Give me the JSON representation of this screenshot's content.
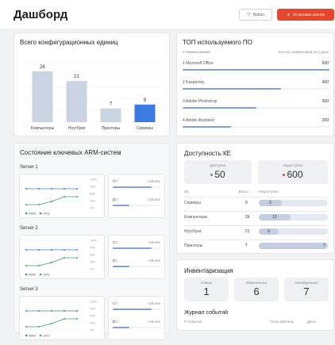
{
  "header": {
    "title": "Дашборд",
    "button_label": "Button",
    "primary_label": "Установка агента"
  },
  "config_units": {
    "title": "Всего конфигурационных единиц",
    "chart_data": {
      "type": "bar",
      "categories": [
        "Компьютеры",
        "Ноутбуки",
        "Принтеры",
        "Серверы"
      ],
      "values": [
        26,
        21,
        7,
        9
      ],
      "highlight_index": 3,
      "colors": {
        "bar": "#c9d3e2",
        "highlight": "#3b7ae0"
      }
    }
  },
  "top_software": {
    "title": "ТОП используемого ПО",
    "col_name": "#  Наименование",
    "col_count": "Кол-во экземпляров за 1 день",
    "items": [
      {
        "label": "1  Microsoft Office",
        "value": "600",
        "fraction": 1.0
      },
      {
        "label": "2  Kaspersky",
        "value": "400",
        "fraction": 0.67
      },
      {
        "label": "3  Adobe Photoshop",
        "value": "300",
        "fraction": 0.5
      },
      {
        "label": "4  Adobe Illustrator",
        "value": "200",
        "fraction": 0.33
      }
    ]
  },
  "arm": {
    "title": "Состояние ключевых ARM-систем",
    "y_ticks": [
      "100%",
      "75%",
      "50%",
      "25%",
      "0%"
    ],
    "legend_ram": "RAM",
    "legend_cpu": "CPU",
    "colors": {
      "ram": "#3b7ae0",
      "cpu": "#3aa657"
    },
    "servers": [
      {
        "name": "Server 1",
        "disk_c": "C:\\",
        "disk_d": "D:\\",
        "volume_label": "Volume",
        "disk_c_fraction": 0.8,
        "disk_d_fraction": 0.35
      },
      {
        "name": "Server 2",
        "disk_c": "C:\\",
        "disk_d": "D:\\",
        "volume_label": "Volume",
        "disk_c_fraction": 0.8,
        "disk_d_fraction": 0.35
      },
      {
        "name": "Server 3",
        "disk_c": "C:\\",
        "disk_d": "D:\\",
        "volume_label": "Volume",
        "disk_c_fraction": 0.8,
        "disk_d_fraction": 0.35
      }
    ]
  },
  "availability": {
    "title": "Доступность КЕ",
    "available_label": "Доступно",
    "available_value": "50",
    "unavailable_label": "Недоступно",
    "unavailable_value": "600",
    "col_ke": "КЕ",
    "col_total": "Всего",
    "col_unavailable": "Недоступно",
    "rows": [
      {
        "name": "Серверы",
        "total": "9",
        "unavail": "3",
        "fraction": 0.33
      },
      {
        "name": "Компьютеры",
        "total": "26",
        "unavail": "12",
        "fraction": 0.46
      },
      {
        "name": "Ноутбуки",
        "total": "21",
        "unavail": "6",
        "fraction": 0.29
      },
      {
        "name": "Принтеры",
        "total": "7",
        "unavail": "7",
        "fraction": 1.0
      }
    ],
    "colors": {
      "available": "#3aa657",
      "unavailable": "#e8462a"
    }
  },
  "inventory": {
    "title": "Инвентаризация",
    "new_label": "Новые",
    "new_value": "1",
    "changed_label": "Измененные",
    "changed_value": "6",
    "missing_label": "Ненайденные",
    "missing_value": "7"
  },
  "events": {
    "title": "Журнал событий",
    "col_event": "#  Событие",
    "col_user": "Пользователь",
    "col_date": "Дата"
  }
}
